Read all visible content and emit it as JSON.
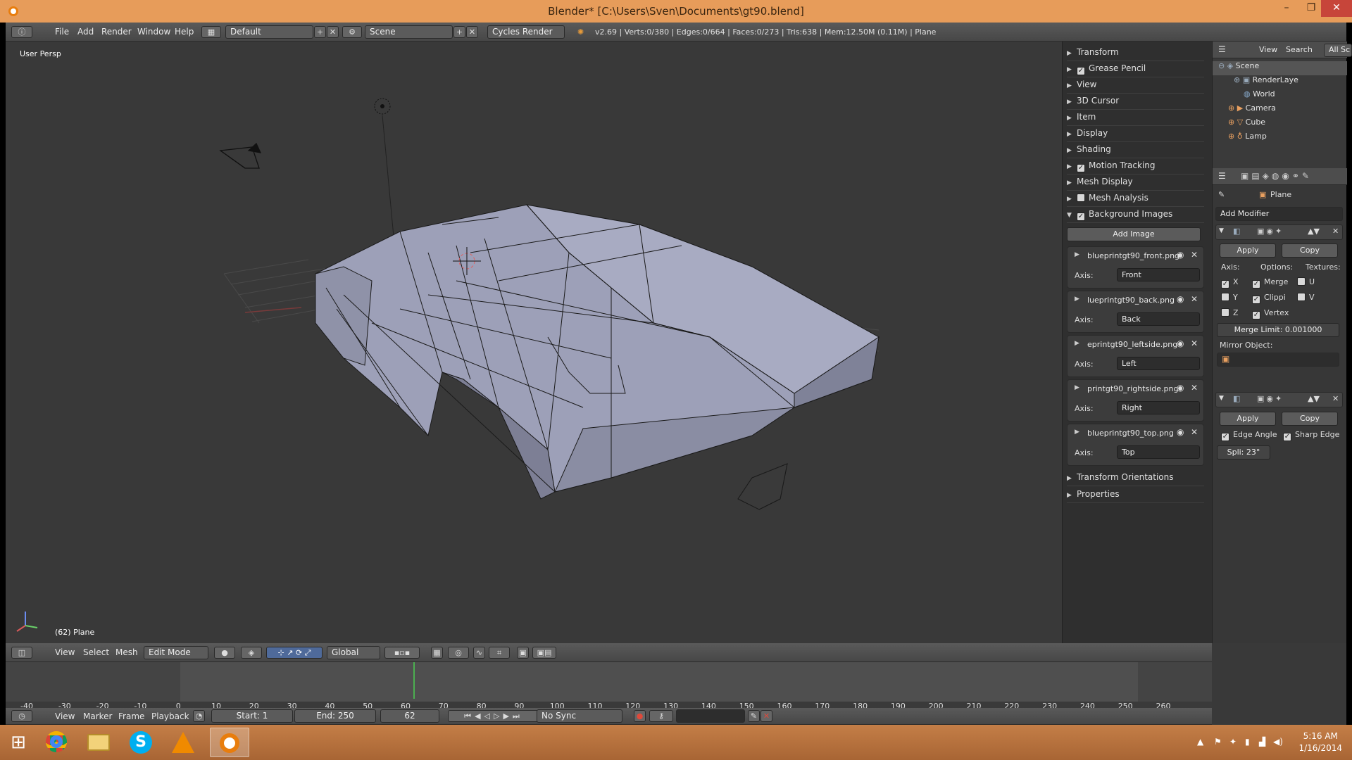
{
  "window": {
    "title": "Blender* [C:\\Users\\Sven\\Documents\\gt90.blend]",
    "min": "–",
    "max": "❐",
    "close": "✕"
  },
  "topbar": {
    "menus": [
      "File",
      "Add",
      "Render",
      "Window",
      "Help"
    ],
    "layout": "Default",
    "scene": "Scene",
    "engine": "Cycles Render",
    "stats": "v2.69 | Verts:0/380 | Edges:0/664 | Faces:0/273 | Tris:638 | Mem:12.50M (0.11M) | Plane"
  },
  "viewport": {
    "label": "User Persp",
    "object_label": "(62) Plane"
  },
  "view_header": {
    "menus": [
      "View",
      "Select",
      "Mesh"
    ],
    "mode": "Edit Mode",
    "orientation": "Global"
  },
  "npanel": {
    "sections_top": [
      {
        "label": "Transform",
        "checkbox": false
      },
      {
        "label": "Grease Pencil",
        "checkbox": true
      },
      {
        "label": "View",
        "checkbox": false
      },
      {
        "label": "3D Cursor",
        "checkbox": false
      },
      {
        "label": "Item",
        "checkbox": false
      },
      {
        "label": "Display",
        "checkbox": false
      },
      {
        "label": "Shading",
        "checkbox": false
      },
      {
        "label": "Motion Tracking",
        "checkbox": true
      },
      {
        "label": "Mesh Display",
        "checkbox": false
      },
      {
        "label": "Mesh Analysis",
        "checkbox": true
      },
      {
        "label": "Background Images",
        "checkbox": true
      }
    ],
    "add_image": "Add Image",
    "axis_label": "Axis:",
    "images": [
      {
        "name": "blueprintgt90_front.png",
        "axis": "Front"
      },
      {
        "name": "lueprintgt90_back.png",
        "axis": "Back"
      },
      {
        "name": "eprintgt90_leftside.png",
        "axis": "Left"
      },
      {
        "name": "printgt90_rightside.png",
        "axis": "Right"
      },
      {
        "name": "blueprintgt90_top.png",
        "axis": "Top"
      }
    ],
    "sections_bottom": [
      "Transform Orientations",
      "Properties"
    ]
  },
  "outliner": {
    "tabs": [
      "View",
      "Search",
      "All Sc"
    ],
    "rows": [
      {
        "label": "Scene",
        "icon": "scene-icon"
      },
      {
        "label": "RenderLaye",
        "icon": "renderlayer-icon"
      },
      {
        "label": "World",
        "icon": "world-icon"
      },
      {
        "label": "Camera",
        "icon": "camera-icon"
      },
      {
        "label": "Cube",
        "icon": "mesh-icon"
      },
      {
        "label": "Lamp",
        "icon": "lamp-icon"
      }
    ]
  },
  "properties": {
    "object": "Plane",
    "add_modifier": "Add Modifier",
    "mirror": {
      "apply": "Apply",
      "copy": "Copy",
      "axis": "Axis:",
      "options": "Options:",
      "textures": "Textures:",
      "x": "X",
      "y": "Y",
      "z": "Z",
      "merge": "Merge",
      "clipping": "Clippi",
      "vertex": "Vertex",
      "u": "U",
      "v": "V",
      "merge_limit": "Merge Limit: 0.001000",
      "mirror_object": "Mirror Object:"
    },
    "edgesplit": {
      "apply": "Apply",
      "copy": "Copy",
      "edge_angle": "Edge Angle",
      "sharp_edge": "Sharp Edge",
      "split": "Spli: 23°"
    }
  },
  "timeline": {
    "ticks": [
      "-40",
      "-30",
      "-20",
      "-10",
      "0",
      "10",
      "20",
      "30",
      "40",
      "50",
      "60",
      "70",
      "80",
      "90",
      "100",
      "110",
      "120",
      "130",
      "140",
      "150",
      "160",
      "170",
      "180",
      "190",
      "200",
      "210",
      "220",
      "230",
      "240",
      "250",
      "260"
    ],
    "current_frame_value": 62,
    "menus": [
      "View",
      "Marker",
      "Frame",
      "Playback"
    ],
    "start": "Start: 1",
    "end": "End: 250",
    "current": "62",
    "sync": "No Sync"
  },
  "taskbar": {
    "time": "5:16 AM",
    "date": "1/16/2014"
  },
  "colors": {
    "title_bg": "#e79c5a",
    "mesh": "#9da0b8",
    "timeline_marker": "#4caf50"
  }
}
